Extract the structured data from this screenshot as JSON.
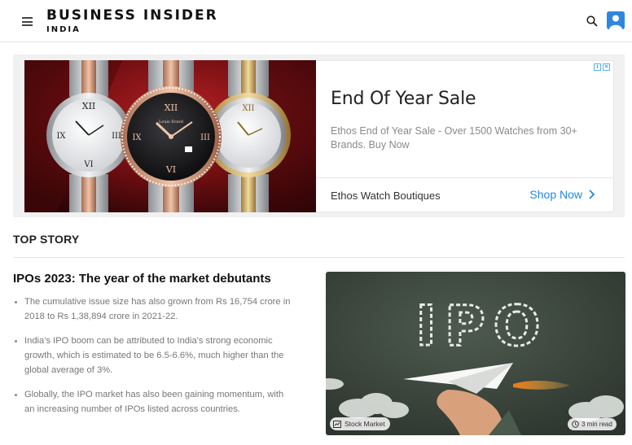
{
  "header": {
    "brand_main": "BUSINESS INSIDER",
    "brand_sub": "INDIA",
    "menu_icon": "hamburger-icon",
    "search_icon": "search-icon",
    "user_icon": "user-avatar-icon"
  },
  "ad": {
    "title": "End Of Year Sale",
    "description": "Ethos End of Year Sale - Over 1500 Watches from 30+ Brands. Buy Now",
    "advertiser": "Ethos Watch Boutiques",
    "cta_label": "Shop Now",
    "badge_icon": "adchoices-icon",
    "close_icon": "close-icon",
    "watch_brand": "Louis Erard",
    "accent_color": "#1e88e5"
  },
  "top_story": {
    "section_title": "TOP STORY",
    "headline": "IPOs 2023: The year of the market debutants",
    "bullets": [
      "The cumulative issue size has also grown from Rs 16,754 crore in 2018 to Rs 1,38,894 crore in 2021-22.",
      "India's IPO boom can be attributed to India's strong economic growth, which is estimated to be 6.5-6.6%, much higher than the global average of 3%.",
      "Globally, the IPO market has also been gaining momentum, with an increasing number of IPOs listed across countries."
    ],
    "image_text": "IPO",
    "category_tag": "Stock Market",
    "read_time": "3 min read"
  }
}
